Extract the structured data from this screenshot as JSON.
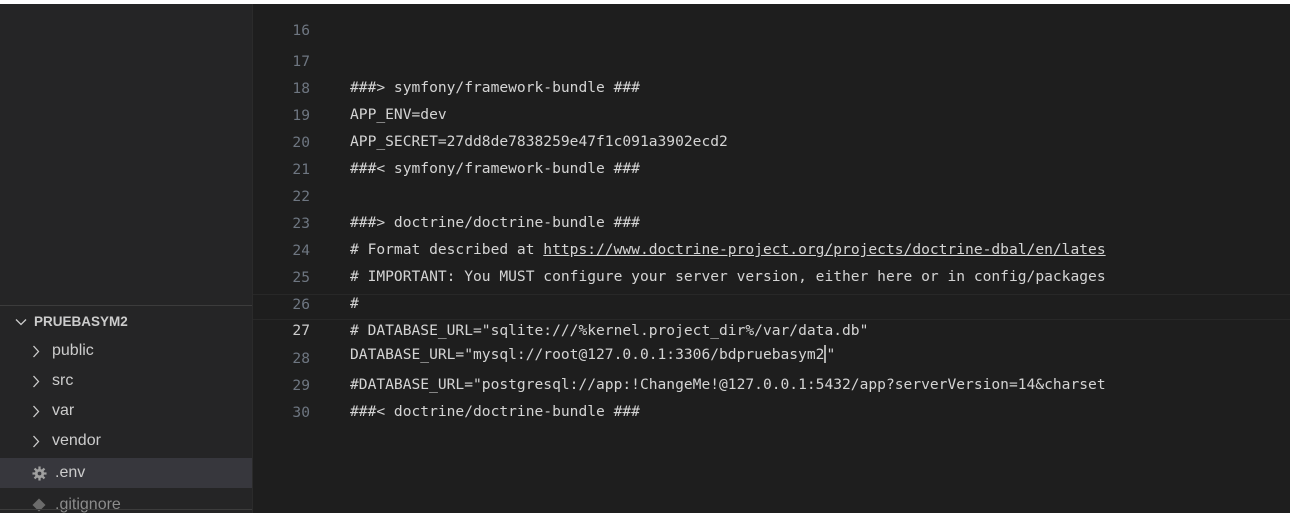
{
  "sidebar": {
    "section_title": "PRUEBASYM2",
    "items": [
      {
        "label": "public",
        "type": "folder"
      },
      {
        "label": "src",
        "type": "folder"
      },
      {
        "label": "var",
        "type": "folder"
      },
      {
        "label": "vendor",
        "type": "folder"
      },
      {
        "label": ".env",
        "type": "file",
        "icon": "gear-icon",
        "selected": true
      },
      {
        "label": ".gitignore",
        "type": "file",
        "icon": "git-icon"
      }
    ]
  },
  "editor": {
    "current_line": "27",
    "lines": [
      {
        "num": "16",
        "text": ""
      },
      {
        "num": "17",
        "text": "###> symfony/framework-bundle ###"
      },
      {
        "num": "18",
        "text": "APP_ENV=dev"
      },
      {
        "num": "19",
        "text": "APP_SECRET=27dd8de7838259e47f1c091a3902ecd2"
      },
      {
        "num": "20",
        "text": "###< symfony/framework-bundle ###"
      },
      {
        "num": "21",
        "text": ""
      },
      {
        "num": "22",
        "text": "###> doctrine/doctrine-bundle ###"
      },
      {
        "num": "23",
        "text": "# Format described at ",
        "link": "https://www.doctrine-project.org/projects/doctrine-dbal/en/lates"
      },
      {
        "num": "24",
        "text": "# IMPORTANT: You MUST configure your server version, either here or in config/packages"
      },
      {
        "num": "25",
        "text": "#"
      },
      {
        "num": "26",
        "text": "# DATABASE_URL=\"sqlite:///%kernel.project_dir%/var/data.db\""
      },
      {
        "num": "27",
        "text": "DATABASE_URL=\"mysql://root@127.0.0.1:3306/bdpruebasym2",
        "after_cursor": "\""
      },
      {
        "num": "28",
        "text": "#DATABASE_URL=\"postgresql://app:!ChangeMe!@127.0.0.1:5432/app?serverVersion=14&charset"
      },
      {
        "num": "29",
        "text": "###< doctrine/doctrine-bundle ###"
      },
      {
        "num": "30",
        "text": ""
      }
    ]
  },
  "colors": {
    "sidebar_bg": "#252526",
    "editor_bg": "#1e1e1e",
    "text": "#d4d4d4",
    "line_number": "#6e7681",
    "selected_item_bg": "#37373d"
  }
}
